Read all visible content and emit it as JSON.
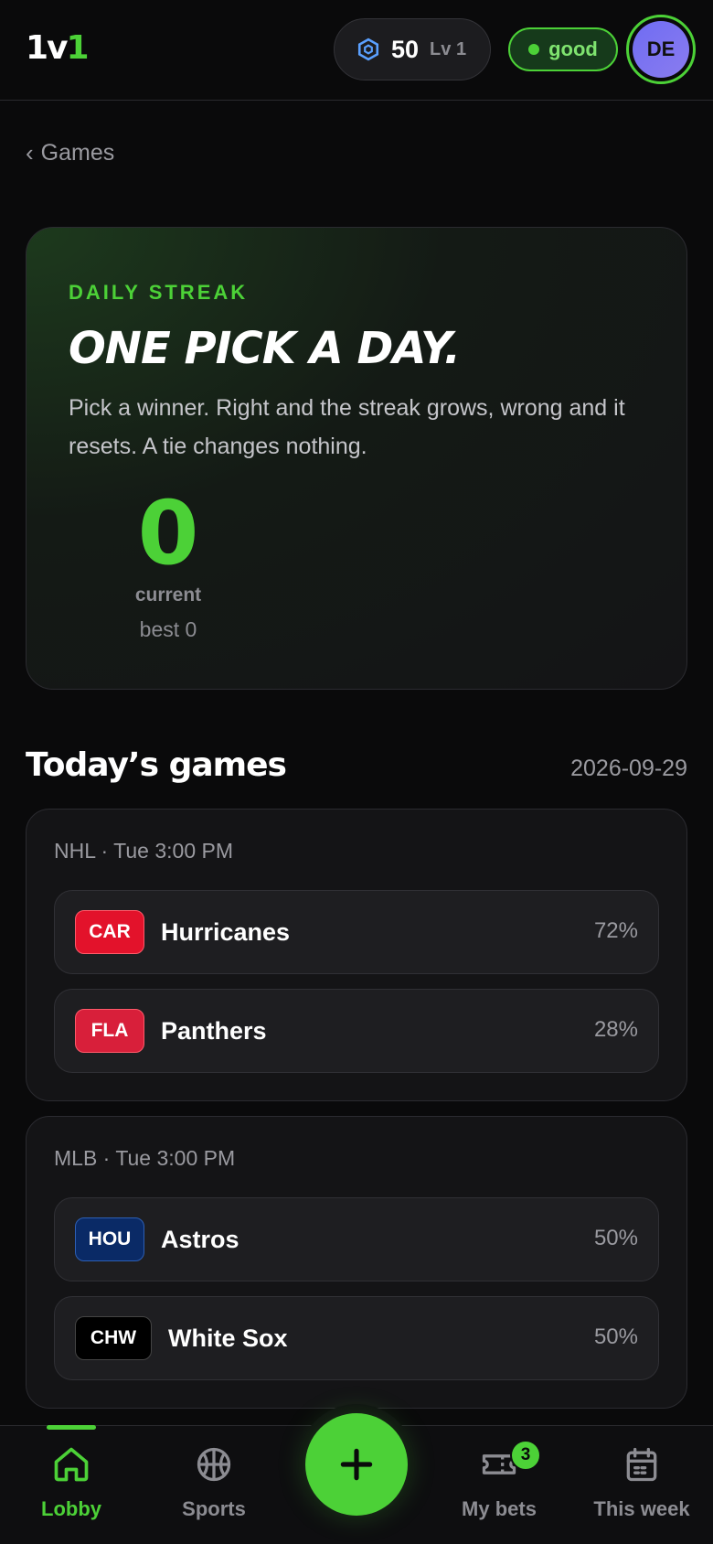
{
  "header": {
    "logo_main": "1v",
    "logo_accent": "1",
    "xp_value": "50",
    "level": "Lv 1",
    "status": "good",
    "avatar_initials": "DE"
  },
  "back": {
    "label": "Games"
  },
  "streak": {
    "kicker": "DAILY STREAK",
    "headline": "ONE PICK A DAY.",
    "description": "Pick a winner. Right and the streak grows, wrong and it resets. A tie changes nothing.",
    "current": "0",
    "current_label": "current",
    "best": "best 0"
  },
  "games_section": {
    "title": "Today’s games",
    "date": "2026-09-29"
  },
  "games": [
    {
      "meta": "NHL · Tue 3:00 PM",
      "teams": [
        {
          "abbr": "CAR",
          "name": "Hurricanes",
          "pct": "72%",
          "color": "#e3122b"
        },
        {
          "abbr": "FLA",
          "name": "Panthers",
          "pct": "28%",
          "color": "#d81f3a"
        }
      ]
    },
    {
      "meta": "MLB · Tue 3:00 PM",
      "teams": [
        {
          "abbr": "HOU",
          "name": "Astros",
          "pct": "50%",
          "color": "#0a2a66"
        },
        {
          "abbr": "CHW",
          "name": "White Sox",
          "pct": "50%",
          "color": "#000000"
        }
      ]
    }
  ],
  "nav": {
    "items": [
      {
        "label": "Lobby",
        "icon": "home-icon"
      },
      {
        "label": "Sports",
        "icon": "basketball-icon"
      },
      {
        "label": "My bets",
        "icon": "ticket-icon"
      },
      {
        "label": "This week",
        "icon": "calendar-icon"
      }
    ],
    "bets_badge": "3",
    "fab_icon": "plus-icon"
  },
  "colors": {
    "accent": "#4cd137",
    "background": "#0a0a0b",
    "card": "#141416"
  }
}
